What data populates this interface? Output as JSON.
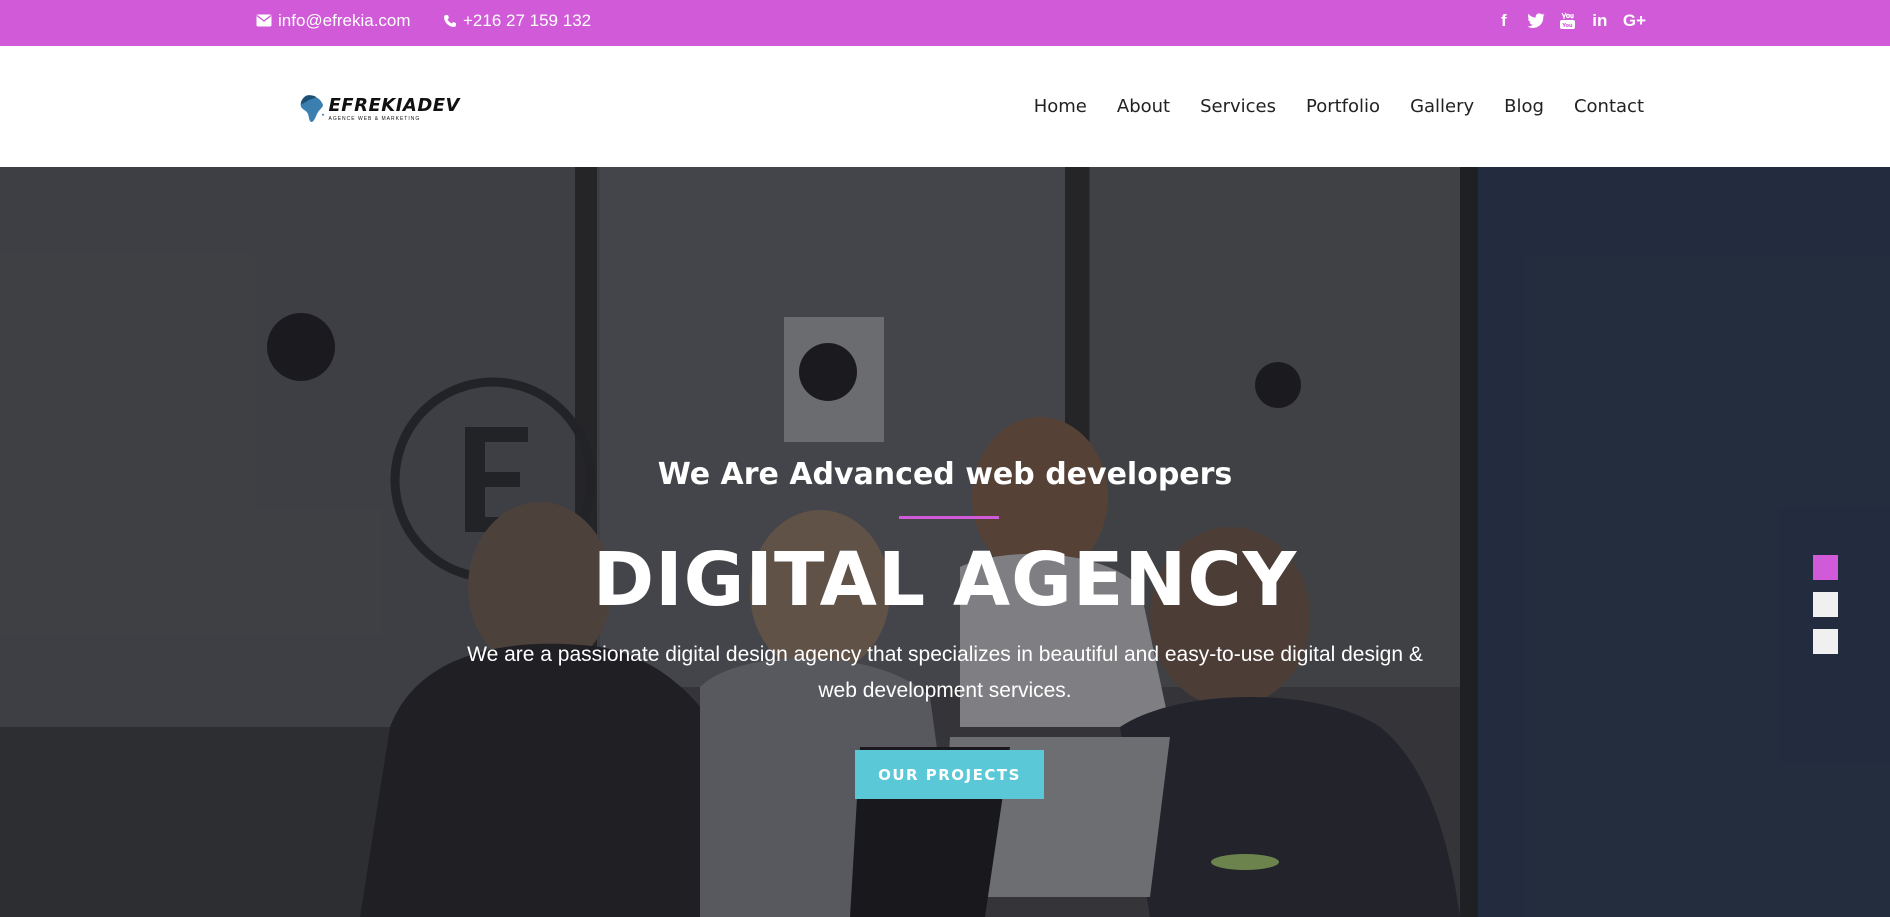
{
  "topbar": {
    "email": "info@efrekia.com",
    "phone": "+216 27 159 132",
    "social_icons": [
      "facebook-icon",
      "twitter-icon",
      "youtube-icon",
      "linkedin-icon",
      "google-plus-icon"
    ],
    "social_glyphs": {
      "facebook": "f",
      "linkedin": "in",
      "google_plus": "G+"
    }
  },
  "header": {
    "logo_name": "EFREKIADEV",
    "logo_tagline": "AGENCE WEB & MARKETING",
    "nav": [
      "Home",
      "About",
      "Services",
      "Portfolio",
      "Gallery",
      "Blog",
      "Contact"
    ]
  },
  "hero": {
    "subtitle": "We Are Advanced web developers",
    "title": "DIGITAL AGENCY",
    "description": "We are a passionate digital design agency that specializes in beautiful and easy-to-use digital design & web development services.",
    "cta_label": "OUR PROJECTS",
    "slides_total": 3,
    "active_slide": 1
  },
  "colors": {
    "accent": "#d05ad8",
    "button": "#5bc8d7",
    "slide_dot_inactive": "#f0f0f0"
  }
}
